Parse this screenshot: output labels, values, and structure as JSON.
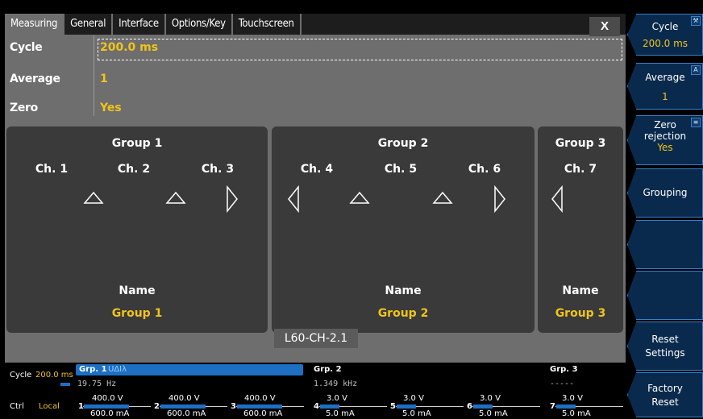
{
  "tabs": [
    {
      "label": "Measuring",
      "active": true
    },
    {
      "label": "General",
      "active": false
    },
    {
      "label": "Interface",
      "active": false
    },
    {
      "label": "Options/Key",
      "active": false
    },
    {
      "label": "Touchscreen",
      "active": false
    }
  ],
  "close_label": "X",
  "params": [
    {
      "label": "Cycle",
      "value": "200.0 ms"
    },
    {
      "label": "Average",
      "value": "1"
    },
    {
      "label": "Zero rejection",
      "value": "Yes"
    }
  ],
  "groups": [
    {
      "title": "Group 1",
      "channels": [
        "Ch. 1",
        "Ch. 2",
        "Ch. 3"
      ],
      "name_label": "Name",
      "name_value": "Group 1"
    },
    {
      "title": "Group 2",
      "channels": [
        "Ch. 4",
        "Ch. 5",
        "Ch. 6"
      ],
      "name_label": "Name",
      "name_value": "Group 2"
    },
    {
      "title": "Group 3",
      "channels": [
        "Ch. 7"
      ],
      "name_label": "Name",
      "name_value": "Group 3"
    }
  ],
  "device_label": "L60-CH-2.1",
  "softkeys": [
    {
      "line1": "Cycle",
      "line2": "200.0 ms",
      "icon": "wrench-icon"
    },
    {
      "line1": "Average",
      "line2": "1",
      "icon": "text-size-icon"
    },
    {
      "line1": "Zero",
      "line1b": "rejection",
      "line2": "Yes",
      "icon": "list-icon"
    },
    {
      "line1": "Grouping"
    },
    {
      "line1": ""
    },
    {
      "line1": ""
    },
    {
      "line1": "Reset",
      "line1b": "Settings"
    },
    {
      "line1": "Factory",
      "line1b": "Reset"
    }
  ],
  "status": {
    "cycle_label": "Cycle",
    "cycle_value": "200.0 ms",
    "ctrl_label": "Ctrl",
    "ctrl_value": "Local",
    "groups": [
      {
        "name": "Grp. 1",
        "mode": "UΔIλ",
        "value": "19.75 Hz"
      },
      {
        "name": "Grp. 2",
        "mode": "",
        "value": "1.349 kHz"
      },
      {
        "name": "Grp. 3",
        "mode": "",
        "value": "-----"
      }
    ],
    "channels": [
      {
        "num": "1",
        "v": "400.0 V",
        "a": "600.0 mA"
      },
      {
        "num": "2",
        "v": "400.0 V",
        "a": "600.0 mA"
      },
      {
        "num": "3",
        "v": "400.0 V",
        "a": "600.0 mA"
      },
      {
        "num": "4",
        "v": "3.0 V",
        "a": "5.0 mA"
      },
      {
        "num": "5",
        "v": "3.0 V",
        "a": "5.0 mA"
      },
      {
        "num": "6",
        "v": "3.0 V",
        "a": "5.0 mA"
      },
      {
        "num": "7",
        "v": "3.0 V",
        "a": "5.0 mA"
      }
    ]
  },
  "colors": {
    "accent_yellow": "#f0c419",
    "panel_gray": "#6e6e6e",
    "group_dark": "#3a3a3a",
    "softkey_blue": "#0a2a4d",
    "softkey_border": "#3a7fc8",
    "status_blue": "#1d6fc4"
  }
}
